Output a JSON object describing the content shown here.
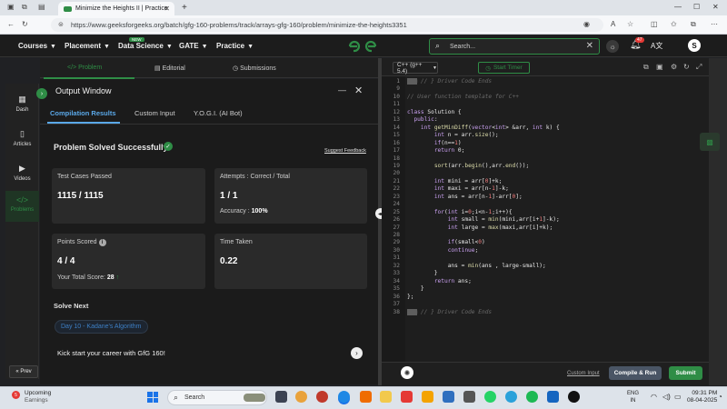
{
  "browser": {
    "tab_title": "Minimize the Heights II | Practice",
    "url": "https://www.geeksforgeeks.org/batch/gfg-160-problems/track/arrays-gfg-160/problem/minimize-the-heights3351"
  },
  "header": {
    "nav": [
      {
        "label": "Courses"
      },
      {
        "label": "Placement"
      },
      {
        "label": "Data Science"
      },
      {
        "label": "GATE"
      },
      {
        "label": "Practice"
      }
    ],
    "new_badge": "NEW",
    "search_placeholder": "Search...",
    "notification_count": "47",
    "avatar_initial": "S"
  },
  "sidebar": {
    "items": [
      {
        "label": "Dash",
        "icon": "dashboard-icon"
      },
      {
        "label": "Articles",
        "icon": "book-icon"
      },
      {
        "label": "Videos",
        "icon": "video-icon"
      },
      {
        "label": "Problems",
        "icon": "code-icon"
      }
    ],
    "prev_label": "Prev"
  },
  "left_tabs": [
    {
      "label": "Problem"
    },
    {
      "label": "Editorial"
    },
    {
      "label": "Submissions"
    }
  ],
  "output_window": {
    "title": "Output Window",
    "tabs": [
      {
        "label": "Compilation Results"
      },
      {
        "label": "Custom Input"
      },
      {
        "label": "Y.O.G.I. (AI Bot)"
      }
    ],
    "status": "Problem Solved Successfully",
    "feedback_link": "Suggest Feedback",
    "cards": {
      "test_cases_label": "Test Cases Passed",
      "test_cases_value": "1115 / 1115",
      "attempts_label": "Attempts : Correct / Total",
      "attempts_value": "1 / 1",
      "accuracy_label": "Accuracy :",
      "accuracy_value": "100%",
      "points_label": "Points Scored",
      "points_value": "4 / 4",
      "total_score_label": "Your Total Score:",
      "total_score_value": "28",
      "time_label": "Time Taken",
      "time_value": "0.22"
    },
    "solve_next_title": "Solve Next",
    "solve_next_item": "Day 10 - Kadane's Algorithm",
    "kick_start": "Kick start your career with GfG 160!"
  },
  "editor": {
    "language": "C++ (g++ 5.4)",
    "timer_label": "Start Timer",
    "custom_input_link": "Custom Input",
    "compile_run_label": "Compile & Run",
    "submit_label": "Submit",
    "lines": [
      {
        "num": "1",
        "text": "// } Driver Code Ends"
      },
      {
        "num": "9",
        "text": ""
      },
      {
        "num": "10",
        "text": "// User function template for C++"
      },
      {
        "num": "11",
        "text": ""
      },
      {
        "num": "12",
        "text": "class Solution {"
      },
      {
        "num": "13",
        "text": "  public:"
      },
      {
        "num": "14",
        "text": "    int getMinDiff(vector<int> &arr, int k) {"
      },
      {
        "num": "15",
        "text": "        int n = arr.size();"
      },
      {
        "num": "16",
        "text": "        if(n==1)"
      },
      {
        "num": "17",
        "text": "        return 0;"
      },
      {
        "num": "18",
        "text": ""
      },
      {
        "num": "19",
        "text": "        sort(arr.begin(),arr.end());"
      },
      {
        "num": "20",
        "text": ""
      },
      {
        "num": "21",
        "text": "        int mini = arr[0]+k;"
      },
      {
        "num": "22",
        "text": "        int maxi = arr[n-1]-k;"
      },
      {
        "num": "23",
        "text": "        int ans = arr[n-1]-arr[0];"
      },
      {
        "num": "24",
        "text": ""
      },
      {
        "num": "25",
        "text": "        for(int i=0;i<n-1;i++){"
      },
      {
        "num": "26",
        "text": "            int small = min(mini,arr[i+1]-k);"
      },
      {
        "num": "27",
        "text": "            int large = max(maxi,arr[i]+k);"
      },
      {
        "num": "28",
        "text": ""
      },
      {
        "num": "29",
        "text": "            if(small<0)"
      },
      {
        "num": "30",
        "text": "            continue;"
      },
      {
        "num": "31",
        "text": ""
      },
      {
        "num": "32",
        "text": "            ans = min(ans , large-small);"
      },
      {
        "num": "33",
        "text": "        }"
      },
      {
        "num": "34",
        "text": "        return ans;"
      },
      {
        "num": "35",
        "text": "    }"
      },
      {
        "num": "36",
        "text": "};"
      },
      {
        "num": "37",
        "text": ""
      },
      {
        "num": "38",
        "text": "// } Driver Code Ends"
      }
    ]
  },
  "taskbar": {
    "weather_title": "Upcoming",
    "weather_sub": "Earnings",
    "weather_badge": "5",
    "search_placeholder": "Search",
    "lang_line1": "ENG",
    "lang_line2": "IN",
    "time": "09:31 PM",
    "date": "08-04-2025"
  },
  "colors": {
    "gfg_green": "#2f8d46",
    "link_blue": "#5aa8e8",
    "panel_dark": "#1b1b1b"
  }
}
